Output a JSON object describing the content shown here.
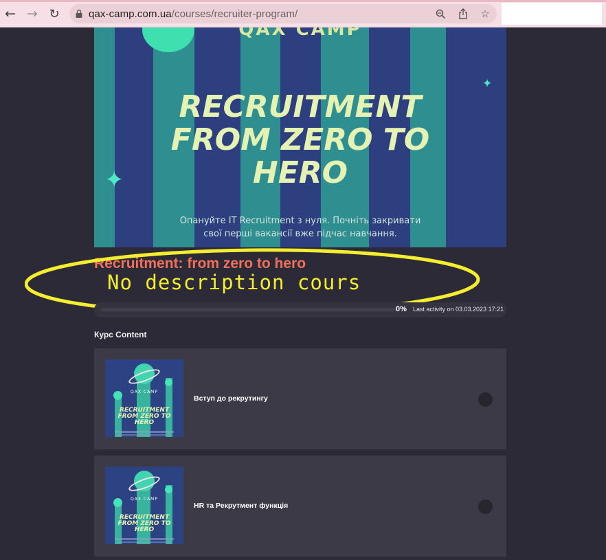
{
  "browser": {
    "url_host": "qax-camp.com.ua",
    "url_path": "/courses/recruiter-program/"
  },
  "banner": {
    "brand": "QAX CAMP",
    "headline_lines": [
      "RECRUITMENT",
      "FROM ZERO TO",
      "HERO"
    ],
    "tagline_lines": [
      "Опануйте IT Recruitment з нуля. Почніть закривати",
      "свої перші вакансії вже підчас навчання."
    ]
  },
  "course": {
    "title": "Recruitment: from zero to hero",
    "annotation": "No description cours",
    "progress_percent": 0,
    "progress_label": "0%",
    "last_activity": "Last activity on 03.03.2023 17:21"
  },
  "content": {
    "section_title": "Курс Content",
    "lessons": [
      {
        "title": "Вступ до рекрутингу",
        "thumb_brand": "QAX CAMP",
        "thumb_title_lines": [
          "RECRUITMENT",
          "FROM ZERO TO",
          "HERO"
        ]
      },
      {
        "title": "HR та Рекрутмент функція",
        "thumb_brand": "QAX CAMP",
        "thumb_title_lines": [
          "RECRUITMENT",
          "FROM ZERO TO",
          "HERO"
        ]
      }
    ]
  },
  "colors": {
    "page_bg": "#2b2a36",
    "title_accent": "#f0705a",
    "annotation": "#f4ee2f",
    "card_bg": "#3b3a46"
  }
}
